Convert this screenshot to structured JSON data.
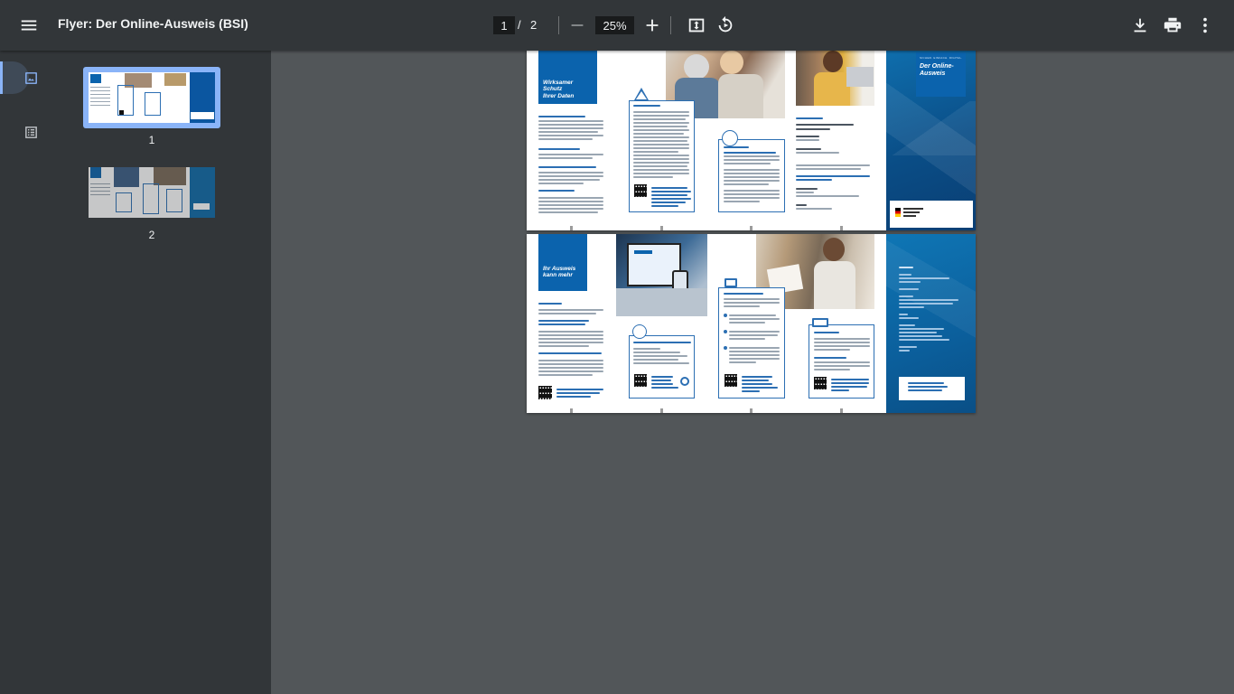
{
  "toolbar": {
    "title": "Flyer: Der Online-Ausweis (BSI)",
    "current_page": "1",
    "page_separator": "/",
    "total_pages": "2",
    "zoom": "25%",
    "icons": {
      "menu": "menu-icon",
      "zoom_out": "minus-icon",
      "zoom_in": "plus-icon",
      "fit": "fit-to-page-icon",
      "rotate": "rotate-icon",
      "download": "download-icon",
      "print": "print-icon",
      "more": "more-vert-icon"
    }
  },
  "sidebar": {
    "tabs": [
      {
        "icon": "thumbnail-icon",
        "active": true
      },
      {
        "icon": "outline-icon",
        "active": false
      }
    ],
    "thumbnails": [
      {
        "label": "1",
        "selected": true
      },
      {
        "label": "2",
        "selected": false
      }
    ]
  },
  "document": {
    "page1": {
      "heading": [
        "Wirksamer Schutz",
        "Ihrer Daten"
      ],
      "cover_title": [
        "Der Online-",
        "Ausweis"
      ],
      "cover_tagline": "SICHER. EINFACH. DIGITAL."
    },
    "page2": {
      "heading": [
        "Ihr Ausweis",
        "kann mehr"
      ]
    }
  },
  "colors": {
    "toolbar": "#323639",
    "viewer_background": "#525659",
    "accent": "#8ab4f8",
    "brand_blue": "#0b63ad"
  }
}
